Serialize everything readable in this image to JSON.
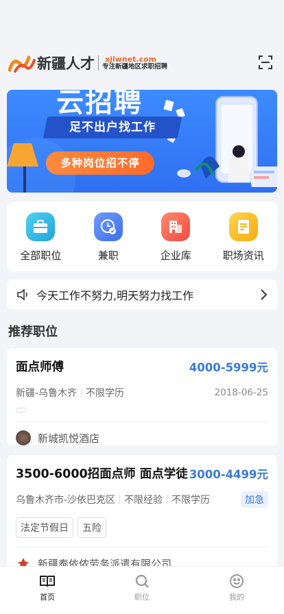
{
  "header": {
    "logo_name": "新疆人才",
    "logo_url": "xjlwnet.com",
    "logo_slogan": "专注新疆地区求职招聘"
  },
  "banner": {
    "title": "云招聘",
    "subtitle": "足不出户找工作",
    "pill": "多种岗位招不停"
  },
  "quick_links": [
    {
      "label": "全部职位",
      "icon": "briefcase-icon",
      "color": "#2bb6e3"
    },
    {
      "label": "兼职",
      "icon": "clock-badge-icon",
      "color": "#4a7ef0"
    },
    {
      "label": "企业库",
      "icon": "building-icon",
      "color": "#f0584c"
    },
    {
      "label": "职场资讯",
      "icon": "document-icon",
      "color": "#f6b91c"
    }
  ],
  "notice": {
    "text": "今天工作不努力,明天努力找工作"
  },
  "section": {
    "title": "推荐职位"
  },
  "jobs": [
    {
      "title": "面点师傅",
      "salary": "4000-5999元",
      "location": "新疆-乌鲁木齐",
      "education": "不限学历",
      "date": "2018-06-25",
      "company": "新城凯悦酒店"
    },
    {
      "title": "3500-6000招面点师 面点学徒",
      "salary": "3000-4499元",
      "location": "乌鲁木齐市-沙依巴克区",
      "experience": "不限经验",
      "education": "不限学历",
      "badge": "加急",
      "tags": [
        "法定节假日",
        "五险"
      ],
      "company": "新疆泰依侬劳务派遣有限公司"
    }
  ],
  "tabbar": [
    {
      "label": "首页",
      "icon": "book-icon",
      "active": true
    },
    {
      "label": "职位",
      "icon": "search-icon",
      "active": false
    },
    {
      "label": "我的",
      "icon": "smiley-icon",
      "active": false
    }
  ],
  "colors": {
    "accent": "#3a7bd5",
    "banner": "#3d8bff",
    "orange": "#ff7a30"
  }
}
